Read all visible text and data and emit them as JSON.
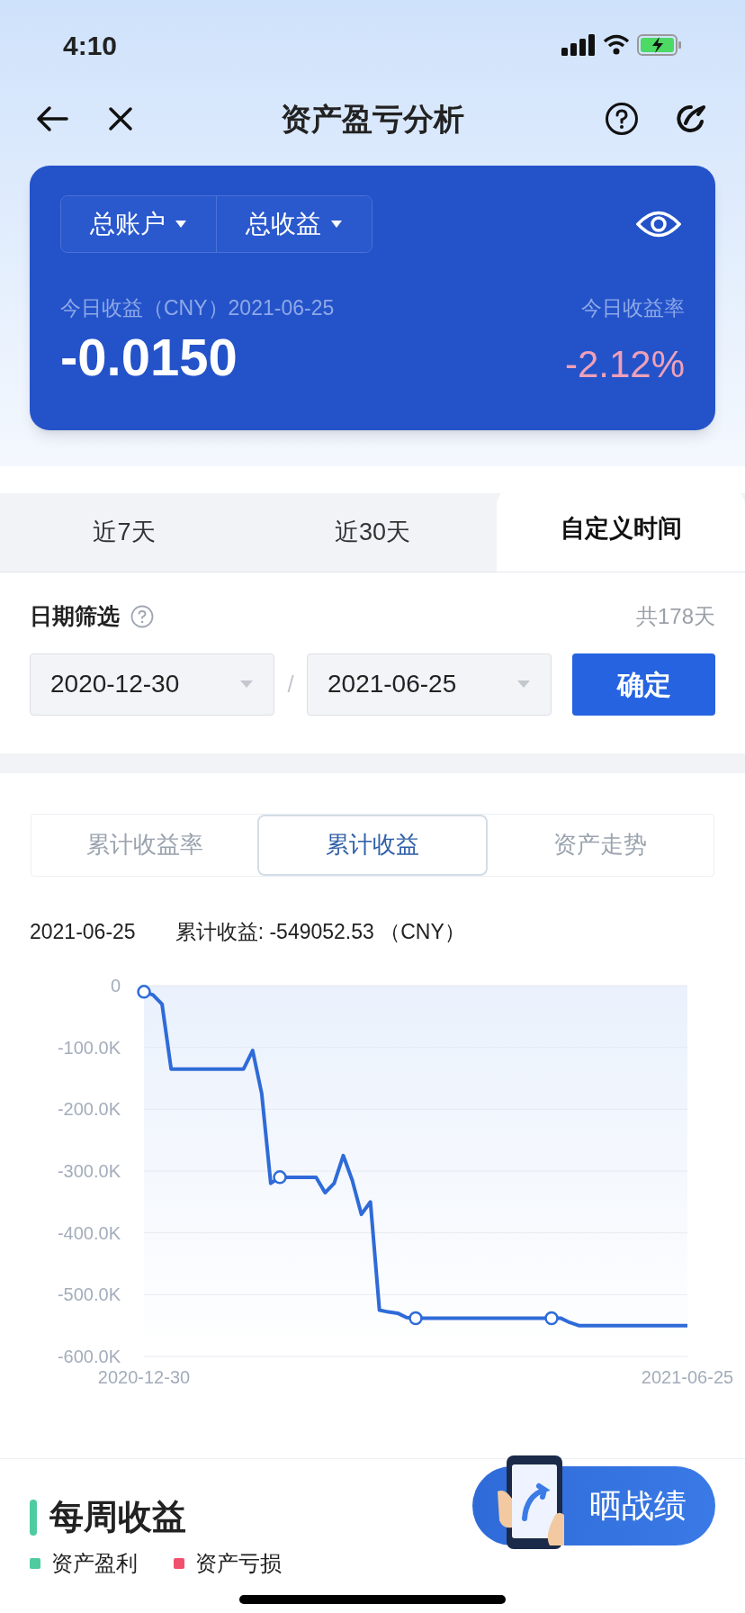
{
  "status_bar": {
    "time": "4:10"
  },
  "nav": {
    "title": "资产盈亏分析"
  },
  "summary_card": {
    "dropdowns": [
      {
        "label": "总账户"
      },
      {
        "label": "总收益"
      }
    ],
    "today_label": "今日收益（CNY）2021-06-25",
    "today_value": "-0.0150",
    "rate_label": "今日收益率",
    "rate_value": "-2.12%"
  },
  "period_tabs": [
    {
      "label": "近7天",
      "selected": false
    },
    {
      "label": "近30天",
      "selected": false
    },
    {
      "label": "自定义时间",
      "selected": true
    }
  ],
  "date_filter": {
    "label": "日期筛选",
    "total": "共178天",
    "start": "2020-12-30",
    "separator": "/",
    "end": "2021-06-25",
    "confirm": "确定"
  },
  "metric_tabs": [
    {
      "label": "累计收益率",
      "selected": false
    },
    {
      "label": "累计收益",
      "selected": true
    },
    {
      "label": "资产走势",
      "selected": false
    }
  ],
  "chart_header": {
    "date": "2021-06-25",
    "summary": "累计收益: -549052.53 （CNY）"
  },
  "chart_data": {
    "type": "line",
    "grid": true,
    "ylim": [
      -600000,
      0
    ],
    "categories": [
      "2020-12-30",
      null,
      null,
      null,
      null,
      null,
      null,
      null,
      null,
      null,
      null,
      null,
      null,
      null,
      null,
      null,
      null,
      null,
      null,
      null,
      null,
      null,
      null,
      null,
      null,
      null,
      null,
      null,
      null,
      null,
      null,
      null,
      null,
      null,
      null,
      null,
      null,
      null,
      null,
      null,
      null,
      null,
      null,
      null,
      null,
      null,
      null,
      null,
      null,
      null,
      null,
      null,
      null,
      null,
      null,
      null,
      null,
      null,
      null,
      null,
      "2021-06-25"
    ],
    "yticks": [
      {
        "value": 0,
        "label": "0"
      },
      {
        "value": -100000,
        "label": "-100.0K"
      },
      {
        "value": -200000,
        "label": "-200.0K"
      },
      {
        "value": -300000,
        "label": "-300.0K"
      },
      {
        "value": -400000,
        "label": "-400.0K"
      },
      {
        "value": -500000,
        "label": "-500.0K"
      },
      {
        "value": -600000,
        "label": "-600.0K"
      }
    ],
    "series": [
      {
        "color": "#2f6bd8",
        "values": [
          -10000,
          -15000,
          -30000,
          -135000,
          -135000,
          -135000,
          -135000,
          -135000,
          -135000,
          -135000,
          -135000,
          -135000,
          -105000,
          -175000,
          -320000,
          -310000,
          -310000,
          -310000,
          -310000,
          -310000,
          -335000,
          -320000,
          -275000,
          -315000,
          -370000,
          -350000,
          -525000,
          -528000,
          -530000,
          -537000,
          -538000,
          -538000,
          -538000,
          -538000,
          -538000,
          -538000,
          -538000,
          -538000,
          -538000,
          -538000,
          -538000,
          -538000,
          -538000,
          -538000,
          -538000,
          -538000,
          -538000,
          -545000,
          -550000,
          -550000,
          -550000,
          -550000,
          -550000,
          -550000,
          -550000,
          -550000,
          -550000,
          -550000,
          -550000,
          -550000,
          -550000
        ]
      }
    ]
  },
  "share_button": {
    "label": "晒战绩"
  },
  "weekly": {
    "title": "每周收益",
    "legend": [
      {
        "label": "资产盈利",
        "color": "#4fcba0"
      },
      {
        "label": "资产亏损",
        "color": "#f0506e"
      }
    ]
  }
}
